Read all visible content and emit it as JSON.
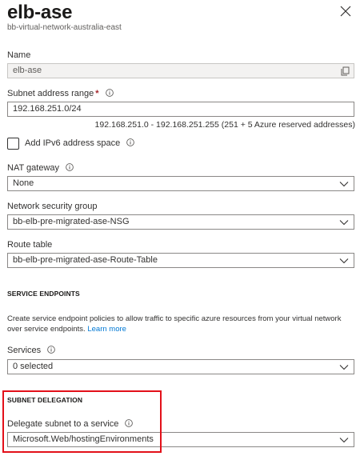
{
  "header": {
    "title": "elb-ase",
    "subtitle": "bb-virtual-network-australia-east"
  },
  "name": {
    "label": "Name",
    "value": "elb-ase"
  },
  "subnet_range": {
    "label": "Subnet address range",
    "required_mark": "*",
    "value": "192.168.251.0/24",
    "hint": "192.168.251.0 - 192.168.251.255 (251 + 5 Azure reserved addresses)"
  },
  "ipv6": {
    "label": "Add IPv6 address space",
    "checked": false
  },
  "nat_gateway": {
    "label": "NAT gateway",
    "value": "None"
  },
  "nsg": {
    "label": "Network security group",
    "value": "bb-elb-pre-migrated-ase-NSG"
  },
  "route_table": {
    "label": "Route table",
    "value": "bb-elb-pre-migrated-ase-Route-Table"
  },
  "service_endpoints": {
    "heading": "SERVICE ENDPOINTS",
    "description": "Create service endpoint policies to allow traffic to specific azure resources from your virtual network over service endpoints.",
    "link": "Learn more",
    "services_label": "Services",
    "services_value": "0 selected"
  },
  "subnet_delegation": {
    "heading": "SUBNET DELEGATION",
    "label": "Delegate subnet to a service",
    "value": "Microsoft.Web/hostingEnvironments"
  },
  "colors": {
    "highlight": "#e3101a",
    "link": "#0078d4",
    "required": "#a4262c"
  },
  "icons": [
    "close-icon",
    "copy-icon",
    "info-icon",
    "chevron-down-icon"
  ]
}
